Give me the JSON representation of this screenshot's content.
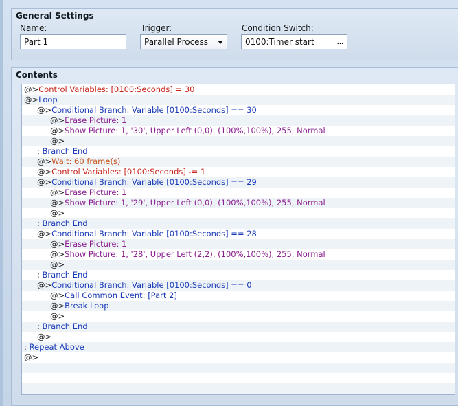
{
  "general": {
    "title": "General Settings",
    "name_label": "Name:",
    "name_value": "Part 1",
    "trigger_label": "Trigger:",
    "trigger_value": "Parallel Process",
    "condition_label": "Condition Switch:",
    "condition_value": "0100:Timer start",
    "condition_button": "..."
  },
  "contents": {
    "title": "Contents",
    "rows": [
      {
        "indent": 0,
        "prefix": "@>",
        "text": "Control Variables: [0100:Seconds] = 30",
        "color": "red"
      },
      {
        "indent": 0,
        "prefix": "@>",
        "text": "Loop",
        "color": "blue"
      },
      {
        "indent": 1,
        "prefix": "@>",
        "text": "Conditional Branch: Variable [0100:Seconds] == 30",
        "color": "blue"
      },
      {
        "indent": 2,
        "prefix": "@>",
        "text": "Erase Picture: 1",
        "color": "purple"
      },
      {
        "indent": 2,
        "prefix": "@>",
        "text": "Show Picture: 1, '30', Upper Left (0,0), (100%,100%), 255, Normal",
        "color": "purple"
      },
      {
        "indent": 2,
        "prefix": "@>",
        "text": "",
        "color": "black"
      },
      {
        "indent": 1,
        "prefix": " : ",
        "text": "Branch End",
        "color": "blue"
      },
      {
        "indent": 1,
        "prefix": "@>",
        "text": "Wait: 60 frame(s)",
        "color": "orange"
      },
      {
        "indent": 1,
        "prefix": "@>",
        "text": "Control Variables: [0100:Seconds] -= 1",
        "color": "red"
      },
      {
        "indent": 1,
        "prefix": "@>",
        "text": "Conditional Branch: Variable [0100:Seconds] == 29",
        "color": "blue"
      },
      {
        "indent": 2,
        "prefix": "@>",
        "text": "Erase Picture: 1",
        "color": "purple"
      },
      {
        "indent": 2,
        "prefix": "@>",
        "text": "Show Picture: 1, '29', Upper Left (0,0), (100%,100%), 255, Normal",
        "color": "purple"
      },
      {
        "indent": 2,
        "prefix": "@>",
        "text": "",
        "color": "black"
      },
      {
        "indent": 1,
        "prefix": " : ",
        "text": "Branch End",
        "color": "blue"
      },
      {
        "indent": 1,
        "prefix": "@>",
        "text": "Conditional Branch: Variable [0100:Seconds] == 28",
        "color": "blue"
      },
      {
        "indent": 2,
        "prefix": "@>",
        "text": "Erase Picture: 1",
        "color": "purple"
      },
      {
        "indent": 2,
        "prefix": "@>",
        "text": "Show Picture: 1, '28', Upper Left (2,2), (100%,100%), 255, Normal",
        "color": "purple"
      },
      {
        "indent": 2,
        "prefix": "@>",
        "text": "",
        "color": "black"
      },
      {
        "indent": 1,
        "prefix": " : ",
        "text": "Branch End",
        "color": "blue"
      },
      {
        "indent": 1,
        "prefix": "@>",
        "text": "Conditional Branch: Variable [0100:Seconds] == 0",
        "color": "blue"
      },
      {
        "indent": 2,
        "prefix": "@>",
        "text": "Call Common Event: [Part 2]",
        "color": "blue"
      },
      {
        "indent": 2,
        "prefix": "@>",
        "text": "Break Loop",
        "color": "blue"
      },
      {
        "indent": 2,
        "prefix": "@>",
        "text": "",
        "color": "black"
      },
      {
        "indent": 1,
        "prefix": " : ",
        "text": "Branch End",
        "color": "blue"
      },
      {
        "indent": 1,
        "prefix": "@>",
        "text": "",
        "color": "black"
      },
      {
        "indent": 0,
        "prefix": " : ",
        "text": "Repeat Above",
        "color": "blue"
      },
      {
        "indent": 0,
        "prefix": "@>",
        "text": "",
        "color": "black"
      },
      {
        "indent": 0,
        "prefix": "",
        "text": "",
        "color": "black"
      },
      {
        "indent": 0,
        "prefix": "",
        "text": "",
        "color": "black"
      },
      {
        "indent": 0,
        "prefix": "",
        "text": "",
        "color": "black"
      }
    ]
  }
}
